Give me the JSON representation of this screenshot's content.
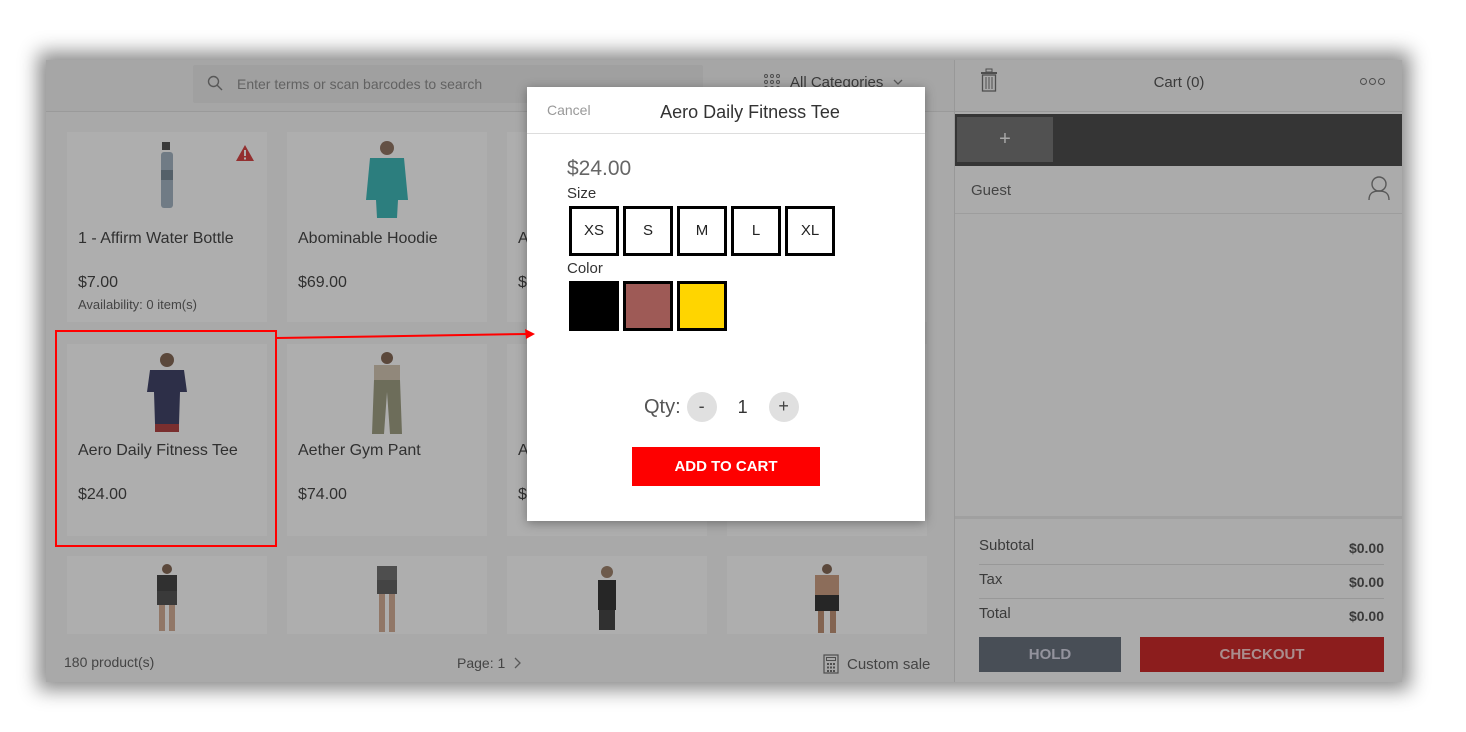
{
  "search": {
    "placeholder": "Enter terms or scan barcodes to search"
  },
  "categories": {
    "label": "All Categories"
  },
  "products": [
    {
      "name": "1 - Affirm Water Bottle",
      "price": "$7.00",
      "availability": "Availability: 0 item(s)",
      "warning": true
    },
    {
      "name": "Abominable Hoodie",
      "price": "$69.00"
    },
    {
      "name": "A",
      "price": "$"
    },
    {
      "name": "Aero Daily Fitness Tee",
      "price": "$24.00"
    },
    {
      "name": "Aether Gym Pant",
      "price": "$74.00"
    },
    {
      "name": "A",
      "price": "$"
    }
  ],
  "footer": {
    "product_count": "180 product(s)",
    "page": "Page: 1",
    "custom_sale": "Custom sale"
  },
  "cart": {
    "title": "Cart (0)",
    "add_tab": "+",
    "customer": "Guest",
    "subtotal_label": "Subtotal",
    "subtotal": "$0.00",
    "tax_label": "Tax",
    "tax": "$0.00",
    "total_label": "Total",
    "total": "$0.00",
    "hold": "HOLD",
    "checkout": "CHECKOUT"
  },
  "modal": {
    "cancel": "Cancel",
    "title": "Aero Daily Fitness Tee",
    "price": "$24.00",
    "size_label": "Size",
    "sizes": [
      "XS",
      "S",
      "M",
      "L",
      "XL"
    ],
    "color_label": "Color",
    "colors": [
      "#000000",
      "#9e5a56",
      "#ffd500"
    ],
    "qty_label": "Qty:",
    "qty_minus": "-",
    "qty_value": "1",
    "qty_plus": "+",
    "add_to_cart": "ADD TO CART"
  },
  "colors": {
    "accent": "#fe0000",
    "checkout": "#c00000",
    "hold": "#4a5563"
  }
}
